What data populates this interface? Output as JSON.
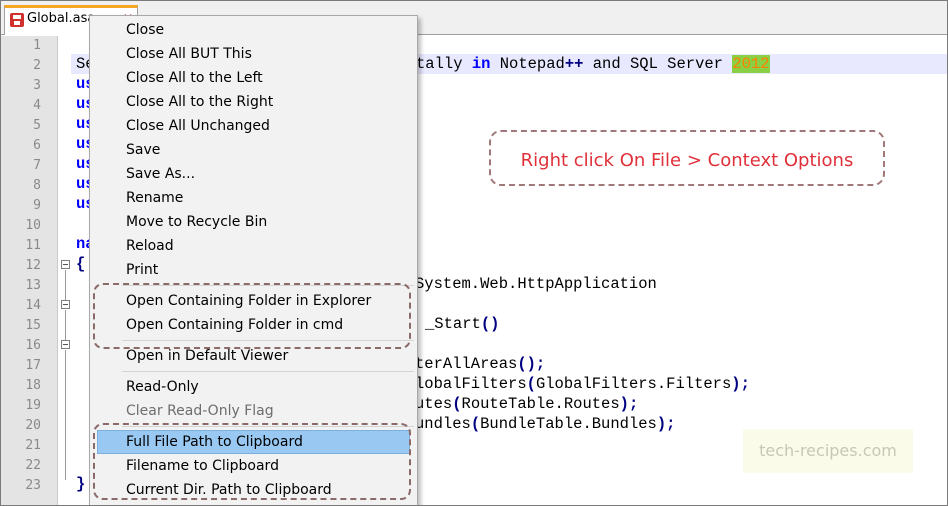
{
  "tab": {
    "label": "Global.asa"
  },
  "gutter": {
    "lines": [
      "1",
      "2",
      "3",
      "4",
      "5",
      "6",
      "7",
      "8",
      "9",
      "10",
      "11",
      "12",
      "13",
      "14",
      "15",
      "16",
      "17",
      "18",
      "19",
      "20",
      "21",
      "22",
      "23"
    ]
  },
  "code": {
    "line2_pre": "Se",
    "line2_mid": "tally ",
    "line2_in": "in",
    "line2_np": " Notepad",
    "line2_pp": "++",
    "line2_and": " and SQL Server ",
    "line2_year": "2012",
    "line3": "us",
    "line4": "us",
    "line5": "us",
    "line6": "us",
    "line7": "us",
    "line8": "us",
    "line9": "us",
    "line11": "na",
    "line12": "{",
    "line13": "System.Web.HttpApplication",
    "line15_a": "_Start",
    "line15_b": "()",
    "line17_a": "terAllAreas",
    "line17_b": "();",
    "line18_a": "lobalFilters",
    "line18_b": "(",
    "line18_c": "GlobalFilters.Filters",
    "line18_d": ");",
    "line19_a": "utes",
    "line19_b": "(",
    "line19_c": "RouteTable.Routes",
    "line19_d": ");",
    "line20_a": "undles",
    "line20_b": "(",
    "line20_c": "BundleTable.Bundles",
    "line20_d": ");",
    "line23": "}"
  },
  "annotation": {
    "text": "Right click On File > Context Options"
  },
  "watermark": {
    "text": "tech-recipes.com"
  },
  "menu": {
    "items": [
      {
        "label": "Close"
      },
      {
        "label": "Close All BUT This"
      },
      {
        "label": "Close All to the Left"
      },
      {
        "label": "Close All to the Right"
      },
      {
        "label": "Close All Unchanged"
      },
      {
        "label": "Save"
      },
      {
        "label": "Save As..."
      },
      {
        "label": "Rename"
      },
      {
        "label": "Move to Recycle Bin"
      },
      {
        "label": "Reload"
      },
      {
        "label": "Print"
      },
      {
        "label": "Open Containing Folder in Explorer"
      },
      {
        "label": "Open Containing Folder in cmd"
      },
      {
        "label": "Open in Default Viewer"
      },
      {
        "label": "Read-Only"
      },
      {
        "label": "Clear Read-Only Flag"
      },
      {
        "label": "Full File Path to Clipboard"
      },
      {
        "label": "Filename to Clipboard"
      },
      {
        "label": "Current Dir. Path to Clipboard"
      }
    ]
  }
}
